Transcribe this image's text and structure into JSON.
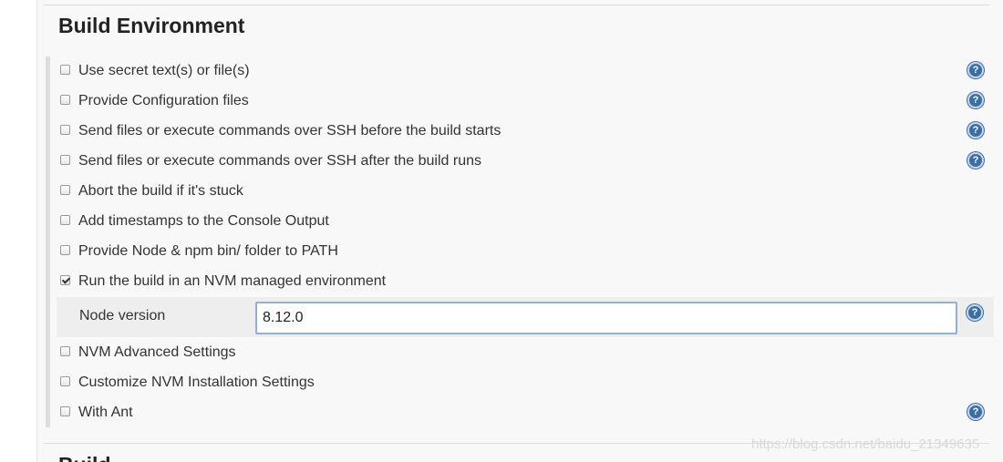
{
  "section": {
    "title": "Build Environment",
    "next_title": "Build"
  },
  "options": [
    {
      "label": "Use secret text(s) or file(s)",
      "checked": false,
      "help": true
    },
    {
      "label": "Provide Configuration files",
      "checked": false,
      "help": true
    },
    {
      "label": "Send files or execute commands over SSH before the build starts",
      "checked": false,
      "help": true
    },
    {
      "label": "Send files or execute commands over SSH after the build runs",
      "checked": false,
      "help": true
    },
    {
      "label": "Abort the build if it's stuck",
      "checked": false,
      "help": false
    },
    {
      "label": "Add timestamps to the Console Output",
      "checked": false,
      "help": false
    },
    {
      "label": "Provide Node & npm bin/ folder to PATH",
      "checked": false,
      "help": false
    },
    {
      "label": "Run the build in an NVM managed environment",
      "checked": true,
      "help": false
    },
    {
      "label": "NVM Advanced Settings",
      "checked": false,
      "help": false
    },
    {
      "label": "Customize NVM Installation Settings",
      "checked": false,
      "help": false
    },
    {
      "label": "With Ant",
      "checked": false,
      "help": true
    }
  ],
  "nvm": {
    "node_version_label": "Node version",
    "node_version_value": "8.12.0"
  },
  "help_icon_glyph": "?",
  "icons": {
    "help": "help-icon",
    "checkbox": "checkbox-icon"
  },
  "colors": {
    "help_icon": "#3b6ea5",
    "input_focus_border": "#8fb1d7",
    "panel_background": "#f8f8f8"
  },
  "watermark": "https://blog.csdn.net/baidu_21349635"
}
